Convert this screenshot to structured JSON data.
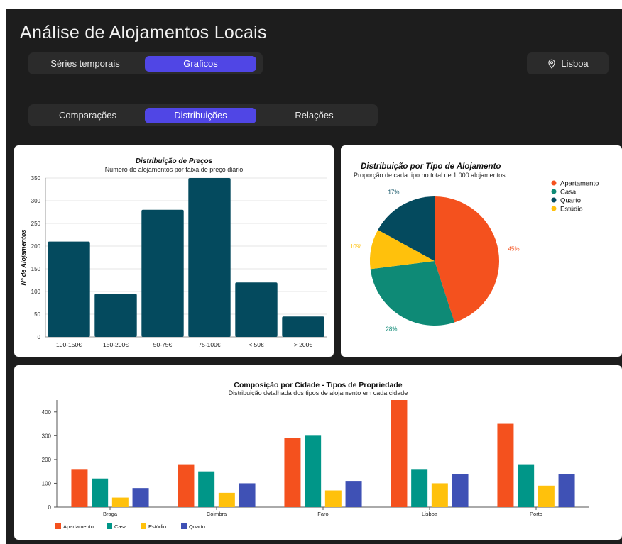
{
  "app": {
    "title": "Análise de Alojamentos Locais"
  },
  "main_tabs": [
    {
      "label": "Séries temporais",
      "active": false
    },
    {
      "label": "Graficos",
      "active": true
    }
  ],
  "location": {
    "label": "Lisboa",
    "icon": "map-pin-icon"
  },
  "sub_tabs": [
    {
      "label": "Comparações",
      "active": false
    },
    {
      "label": "Distribuições",
      "active": true
    },
    {
      "label": "Relações",
      "active": false
    }
  ],
  "colors": {
    "accent": "#5046e5",
    "bar": "#044a5e",
    "apartamento": "#f4511e",
    "casa": "#0e8a76",
    "quarto": "#044a5e",
    "estudio": "#ffc10c",
    "quarto_bar": "#3f51b5",
    "casa_bar": "#009688"
  },
  "chart_data": [
    {
      "type": "bar",
      "title": "Distribuição de Preços",
      "subtitle": "Número de alojamentos por faixa de preço diário",
      "xlabel": "",
      "ylabel": "Nº de Alojamentos",
      "categories": [
        "100-150€",
        "150-200€",
        "50-75€",
        "75-100€",
        "< 50€",
        "> 200€"
      ],
      "values": [
        210,
        95,
        280,
        350,
        120,
        45
      ],
      "ylim": [
        0,
        350
      ],
      "yticks": [
        0,
        50,
        100,
        150,
        200,
        250,
        300,
        350
      ],
      "grid": true
    },
    {
      "type": "pie",
      "title": "Distribuição por Tipo de Alojamento",
      "subtitle": "Proporção de cada tipo no total de 1.000 alojamentos",
      "labels": [
        "Apartamento",
        "Casa",
        "Estúdio",
        "Quarto"
      ],
      "values": [
        45,
        28,
        10,
        17
      ],
      "percent_labels": [
        "45%",
        "28%",
        "10%",
        "17%"
      ],
      "legend": [
        "Apartamento",
        "Casa",
        "Quarto",
        "Estúdio"
      ],
      "legend_placement": "top-right"
    },
    {
      "type": "bar",
      "title": "Composição por Cidade - Tipos de Propriedade",
      "subtitle": "Distribuição detalhada dos tipos de alojamento em cada cidade",
      "categories": [
        "Braga",
        "Coimbra",
        "Faro",
        "Lisboa",
        "Porto"
      ],
      "series": [
        {
          "name": "Apartamento",
          "values": [
            160,
            180,
            290,
            450,
            350
          ]
        },
        {
          "name": "Casa",
          "values": [
            120,
            150,
            300,
            160,
            180
          ]
        },
        {
          "name": "Estúdio",
          "values": [
            40,
            60,
            70,
            100,
            90
          ]
        },
        {
          "name": "Quarto",
          "values": [
            80,
            100,
            110,
            140,
            140
          ]
        }
      ],
      "ylim": [
        0,
        450
      ],
      "yticks": [
        0,
        100,
        200,
        300,
        400
      ],
      "legend_placement": "bottom-left",
      "grid": false
    }
  ]
}
